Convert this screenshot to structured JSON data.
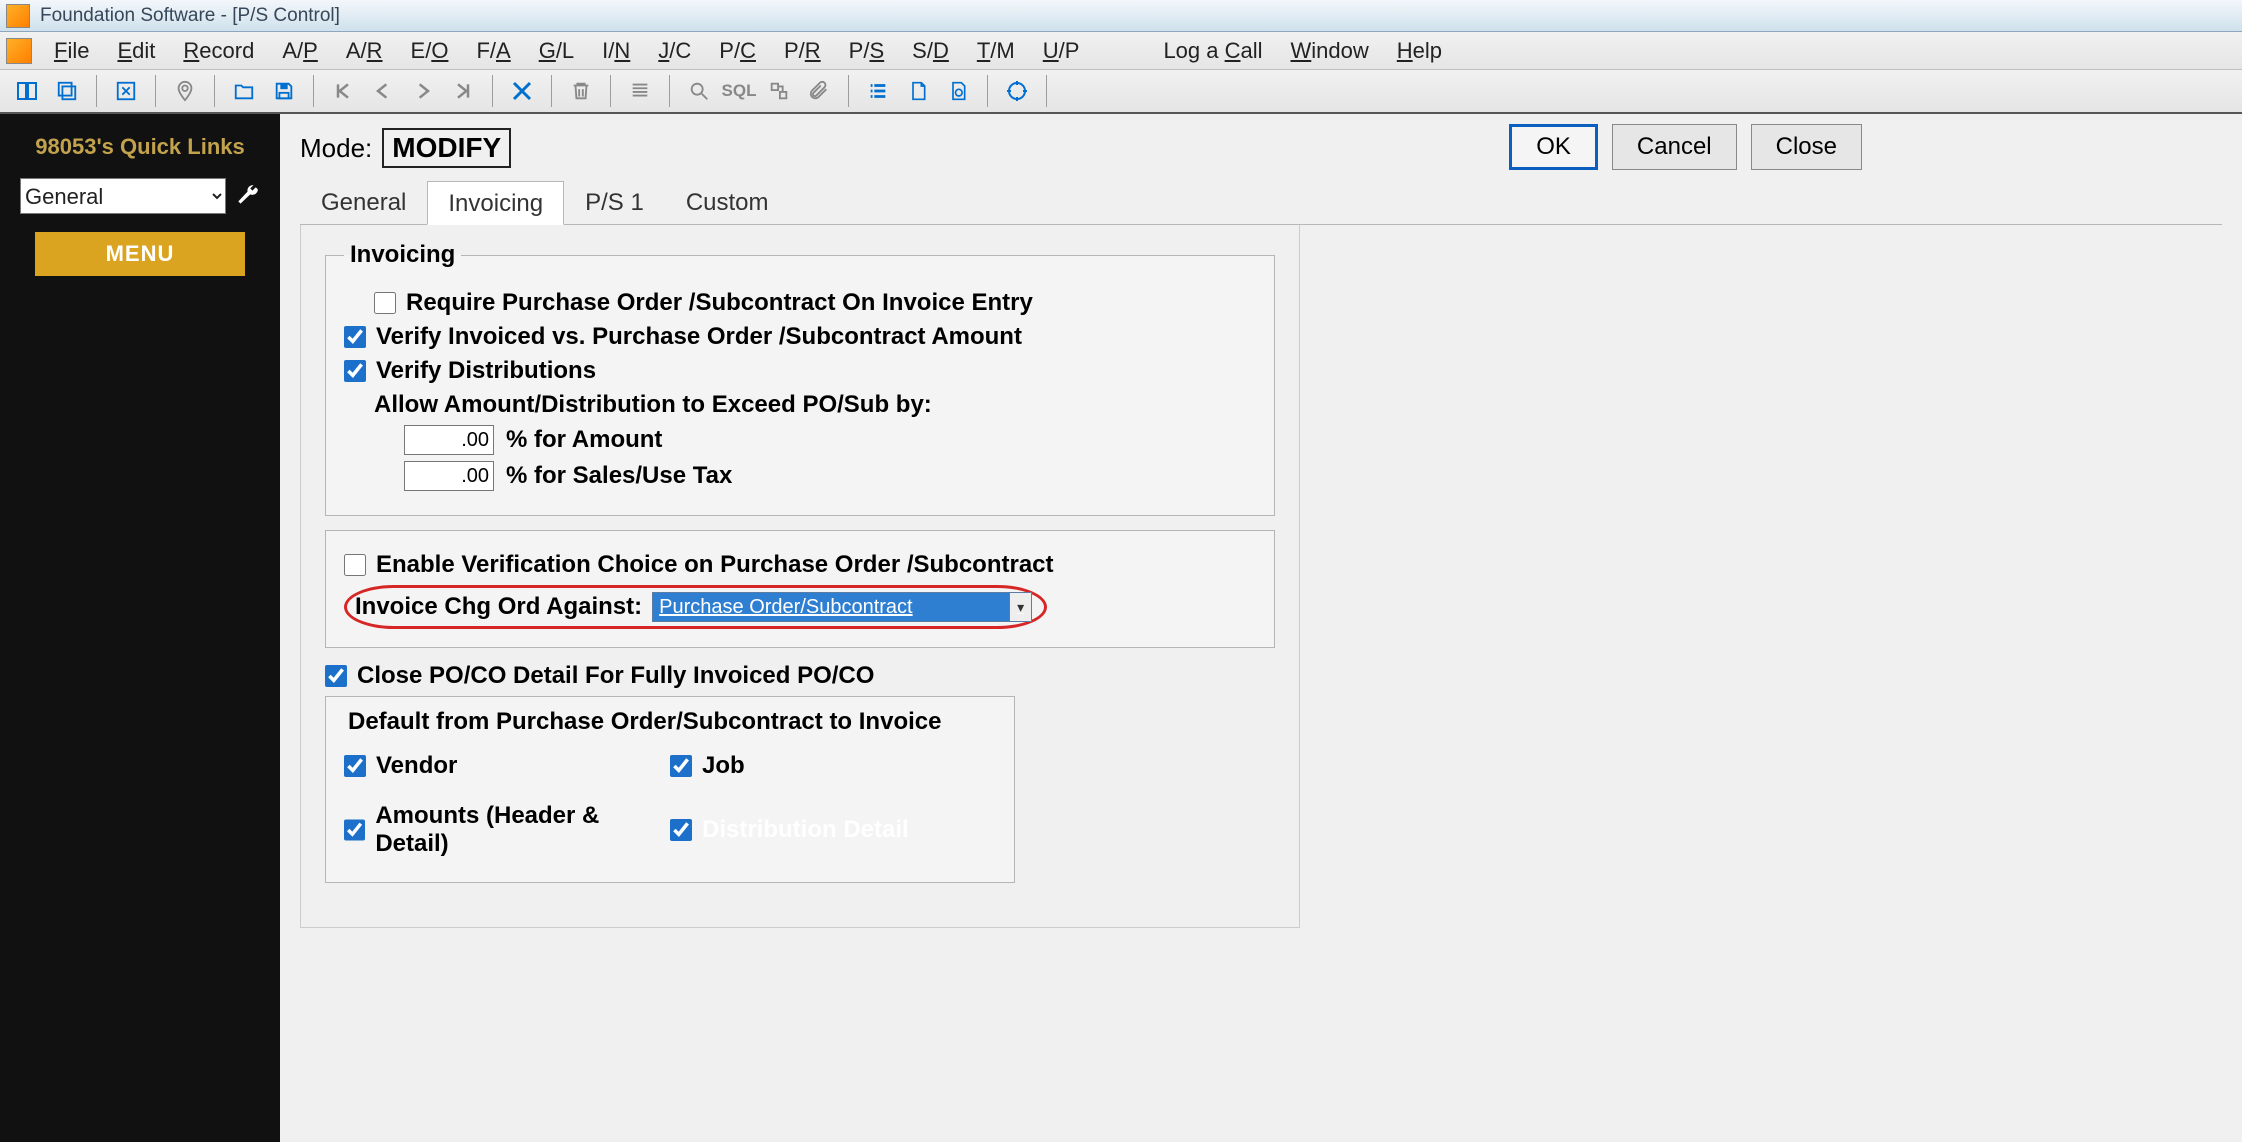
{
  "titlebar": {
    "title": "Foundation Software - [P/S Control]"
  },
  "menubar": {
    "items": [
      "File",
      "Edit",
      "Record",
      "A/P",
      "A/R",
      "E/O",
      "F/A",
      "G/L",
      "I/N",
      "J/C",
      "P/C",
      "P/R",
      "P/S",
      "S/D",
      "T/M",
      "U/P"
    ],
    "right_items": [
      "Log a Call",
      "Window",
      "Help"
    ]
  },
  "sidebar": {
    "quick_links_title": "98053's Quick Links",
    "dropdown_value": "General",
    "menu_label": "MENU"
  },
  "content": {
    "mode_label": "Mode:",
    "mode_value": "MODIFY",
    "buttons": {
      "ok": "OK",
      "cancel": "Cancel",
      "close": "Close"
    },
    "tabs": [
      "General",
      "Invoicing",
      "P/S 1",
      "Custom"
    ],
    "active_tab_index": 1,
    "invoicing": {
      "fieldset_label": "Invoicing",
      "require_po": {
        "checked": false,
        "label": "Require Purchase Order /Subcontract On Invoice Entry"
      },
      "verify_invoiced": {
        "checked": true,
        "label": "Verify Invoiced vs. Purchase Order /Subcontract Amount"
      },
      "verify_dist": {
        "checked": true,
        "label": "Verify Distributions"
      },
      "allow_exceed_label": "Allow Amount/Distribution to Exceed PO/Sub by:",
      "pct_amount_value": ".00",
      "pct_amount_label": "% for Amount",
      "pct_tax_value": ".00",
      "pct_tax_label": "% for Sales/Use Tax",
      "enable_verification": {
        "checked": false,
        "label": "Enable Verification Choice on Purchase Order /Subcontract"
      },
      "invoice_chg_label": "Invoice Chg Ord Against:",
      "invoice_chg_value": "Purchase Order/Subcontract",
      "close_poco": {
        "checked": true,
        "label": "Close PO/CO Detail For Fully Invoiced PO/CO"
      },
      "default_group_label": "Default from Purchase Order/Subcontract to Invoice",
      "def_vendor": {
        "checked": true,
        "label": "Vendor"
      },
      "def_job": {
        "checked": true,
        "label": "Job"
      },
      "def_amounts": {
        "checked": true,
        "label": "Amounts (Header & Detail)"
      },
      "def_dist": {
        "checked": true,
        "label": "Distribution Detail"
      }
    }
  }
}
